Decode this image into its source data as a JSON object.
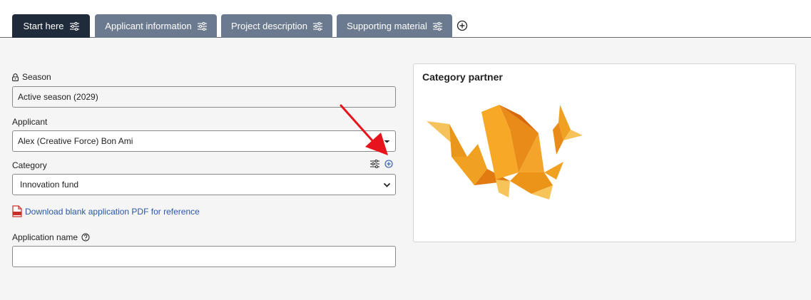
{
  "tabs": [
    {
      "label": "Start here",
      "active": true
    },
    {
      "label": "Applicant information",
      "active": false
    },
    {
      "label": "Project description",
      "active": false
    },
    {
      "label": "Supporting material",
      "active": false
    }
  ],
  "form": {
    "season": {
      "label": "Season",
      "value": "Active season (2029)",
      "locked": true
    },
    "applicant": {
      "label": "Applicant",
      "value": "Alex (Creative Force) Bon Ami"
    },
    "category": {
      "label": "Category",
      "value": "Innovation fund"
    },
    "pdf_link": "Download blank application PDF for reference",
    "application_name": {
      "label": "Application name",
      "value": ""
    }
  },
  "panel": {
    "title": "Category partner"
  },
  "colors": {
    "tab_active": "#1f2b3a",
    "tab_inactive": "#6b7a8f",
    "link": "#2a56a8",
    "arrow": "#e8141b"
  }
}
